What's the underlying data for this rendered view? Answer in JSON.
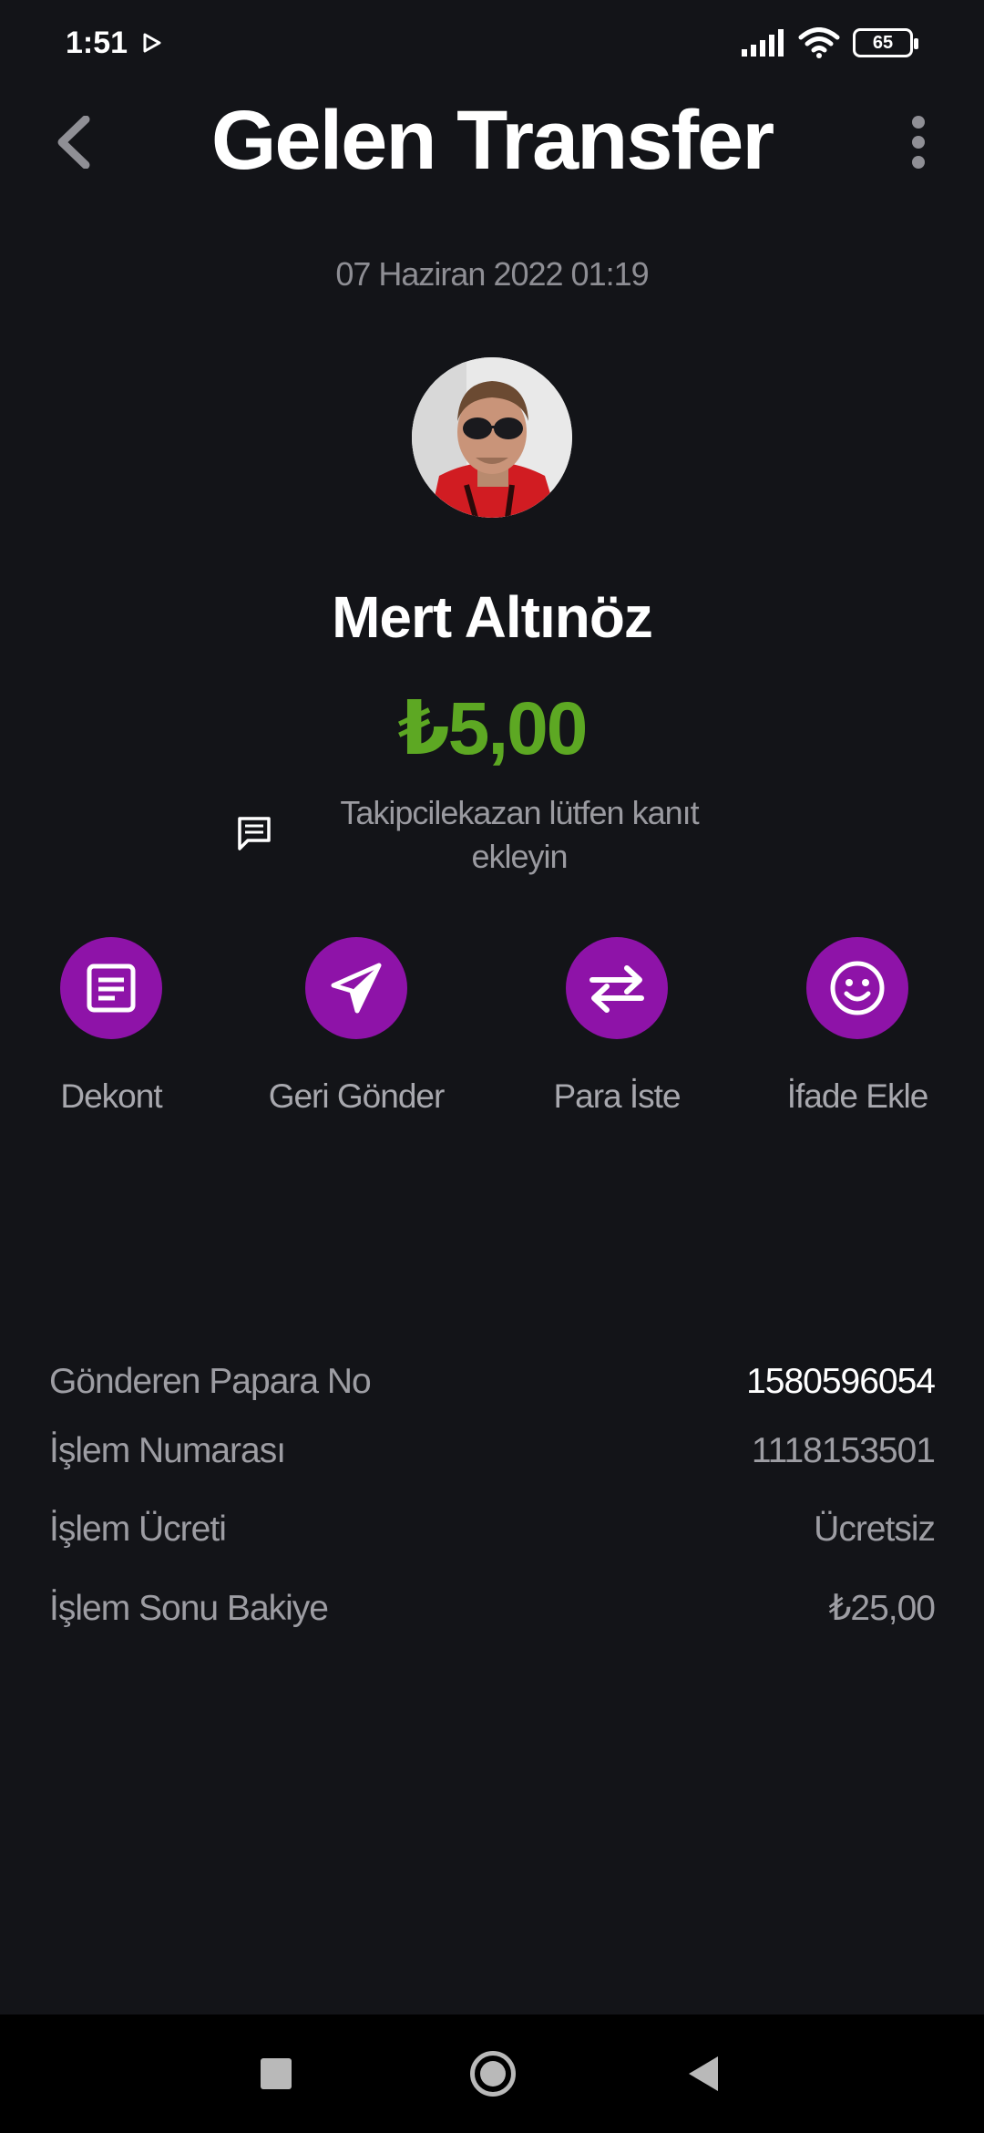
{
  "status_bar": {
    "time": "1:51",
    "battery": "65"
  },
  "header": {
    "title": "Gelen Transfer"
  },
  "transaction": {
    "date": "07 Haziran 2022 01:19",
    "sender_name": "Mert Altınöz",
    "amount": "₺5,00",
    "note": "Takipcilekazan lütfen kanıt ekleyin"
  },
  "actions": [
    {
      "label": "Dekont",
      "icon": "receipt-icon"
    },
    {
      "label": "Geri Gönder",
      "icon": "send-icon"
    },
    {
      "label": "Para İste",
      "icon": "swap-icon"
    },
    {
      "label": "İfade Ekle",
      "icon": "smiley-icon"
    }
  ],
  "details": [
    {
      "label": "Gönderen Papara No",
      "value": "1580596054"
    },
    {
      "label": "İşlem Numarası",
      "value": "1118153501"
    },
    {
      "label": "İşlem Ücreti",
      "value": "Ücretsiz"
    },
    {
      "label": "İşlem Sonu Bakiye",
      "value": "₺25,00"
    }
  ],
  "colors": {
    "background": "#131418",
    "accent": "#8e13a8",
    "amount": "#5da823"
  }
}
